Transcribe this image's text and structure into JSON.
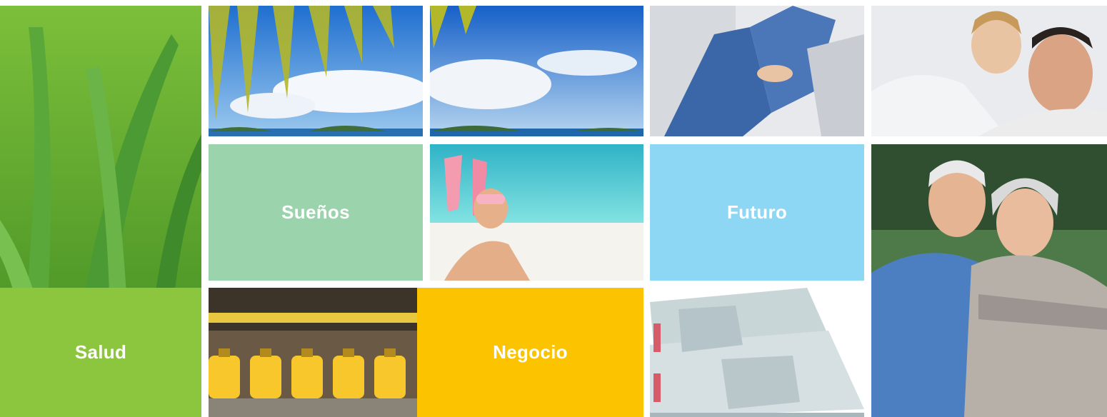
{
  "tiles": {
    "suenos": {
      "label": "Sueños"
    },
    "futuro": {
      "label": "Futuro"
    },
    "salud": {
      "label": "Salud"
    },
    "negocio": {
      "label": "Negocio"
    }
  },
  "colors": {
    "suenos": "#9bd3ad",
    "futuro": "#8dd7f4",
    "salud": "#8cc63f",
    "negocio": "#fbc300"
  },
  "photos": [
    "aloe-vera-photo",
    "palm-beach-photo",
    "ocean-sky-photo",
    "relaxing-person-photo",
    "father-child-photo",
    "snorkel-woman-photo",
    "elderly-couple-photo",
    "bottling-factory-photo",
    "banknotes-photo"
  ]
}
